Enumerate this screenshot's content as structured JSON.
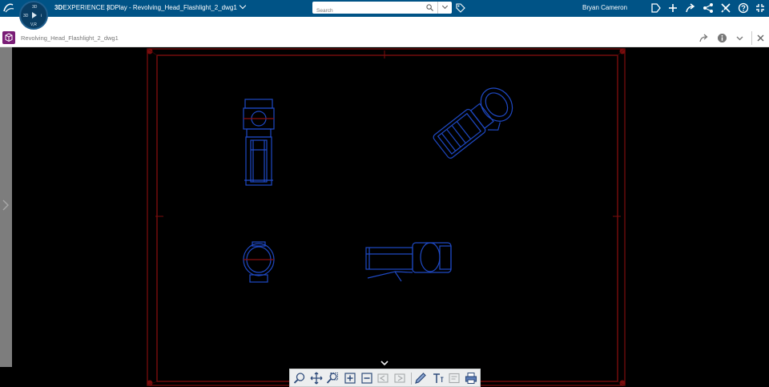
{
  "topbar": {
    "brand_bold": "3D",
    "brand_rest": "EXPERIENCE |",
    "title": "3DPlay - Revolving_Head_Flashlight_2_dwg1",
    "search_placeholder": "Search",
    "user_name": "Bryan Cameron",
    "compass_labels": {
      "top": "3D",
      "left": "3D",
      "right": "i",
      "bottom": "V,R"
    }
  },
  "subbar": {
    "document_title": "Revolving_Head_Flashlight_2_dwg1"
  },
  "icons": {
    "logo": "ds-logo-icon",
    "compass": "compass-icon",
    "search": "search-icon",
    "tag": "tag-icon",
    "share": "share-icon",
    "add": "plus-icon",
    "network": "network-icon",
    "tools": "tools-icon",
    "help": "help-icon",
    "fullscreen": "fullscreen-icon",
    "info": "info-icon",
    "close": "close-icon"
  },
  "colors": {
    "topbar_bg": "#005386",
    "app_badge": "#7a1d76",
    "drawing_blue": "#1f49c4",
    "frame_red": "#7a0d0d",
    "panel_gray": "#7d7d7d"
  },
  "toolbar": {
    "tools": [
      "zoom-tool",
      "pan-tool",
      "zoom-area-tool",
      "zoom-in-tool",
      "zoom-out-tool",
      "previous-sheet-tool",
      "next-sheet-tool",
      "markup-pen-tool",
      "text-tool",
      "note-tool",
      "print-tool"
    ]
  }
}
